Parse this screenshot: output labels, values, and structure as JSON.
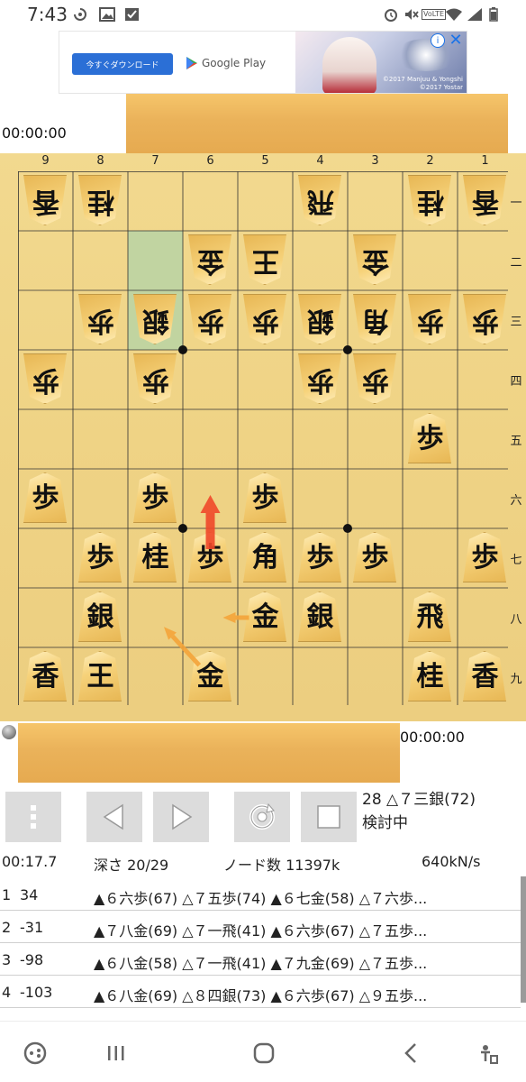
{
  "status_bar": {
    "time": "7:43",
    "left_icons": [
      "sync-icon",
      "image-icon",
      "check-box-icon"
    ],
    "right_icons": [
      "alarm-icon",
      "mute-icon",
      "volte-icon",
      "wifi-icon",
      "signal-icon",
      "battery-icon"
    ],
    "volte": "VoLTE"
  },
  "ad": {
    "button_label": "今すぐダウンロード",
    "store_label": "Google Play",
    "copyright_1": "©2017 Manjuu & Yongshi",
    "copyright_2": "©2017 Yostar",
    "info_symbol": "i",
    "close_symbol": "✕"
  },
  "timers": {
    "opponent": "00:00:00",
    "player": "00:00:00"
  },
  "board": {
    "file_labels": [
      "9",
      "8",
      "7",
      "6",
      "5",
      "4",
      "3",
      "2",
      "1"
    ],
    "rank_labels": [
      "一",
      "二",
      "三",
      "四",
      "五",
      "六",
      "七",
      "八",
      "九"
    ],
    "highlight_squares": [
      {
        "file": 7,
        "rank": 2
      },
      {
        "file": 7,
        "rank": 3
      }
    ],
    "pieces": [
      {
        "file": 9,
        "rank": 1,
        "char": "香",
        "side": "gote"
      },
      {
        "file": 8,
        "rank": 1,
        "char": "桂",
        "side": "gote"
      },
      {
        "file": 4,
        "rank": 1,
        "char": "飛",
        "side": "gote"
      },
      {
        "file": 2,
        "rank": 1,
        "char": "桂",
        "side": "gote"
      },
      {
        "file": 1,
        "rank": 1,
        "char": "香",
        "side": "gote"
      },
      {
        "file": 6,
        "rank": 2,
        "char": "金",
        "side": "gote"
      },
      {
        "file": 5,
        "rank": 2,
        "char": "王",
        "side": "gote"
      },
      {
        "file": 3,
        "rank": 2,
        "char": "金",
        "side": "gote"
      },
      {
        "file": 8,
        "rank": 3,
        "char": "歩",
        "side": "gote"
      },
      {
        "file": 7,
        "rank": 3,
        "char": "銀",
        "side": "gote"
      },
      {
        "file": 6,
        "rank": 3,
        "char": "歩",
        "side": "gote"
      },
      {
        "file": 5,
        "rank": 3,
        "char": "歩",
        "side": "gote"
      },
      {
        "file": 4,
        "rank": 3,
        "char": "銀",
        "side": "gote"
      },
      {
        "file": 3,
        "rank": 3,
        "char": "角",
        "side": "gote"
      },
      {
        "file": 2,
        "rank": 3,
        "char": "歩",
        "side": "gote"
      },
      {
        "file": 1,
        "rank": 3,
        "char": "歩",
        "side": "gote"
      },
      {
        "file": 9,
        "rank": 4,
        "char": "歩",
        "side": "gote"
      },
      {
        "file": 7,
        "rank": 4,
        "char": "歩",
        "side": "gote"
      },
      {
        "file": 4,
        "rank": 4,
        "char": "歩",
        "side": "gote"
      },
      {
        "file": 3,
        "rank": 4,
        "char": "歩",
        "side": "gote"
      },
      {
        "file": 2,
        "rank": 5,
        "char": "歩",
        "side": "sente"
      },
      {
        "file": 9,
        "rank": 6,
        "char": "歩",
        "side": "sente"
      },
      {
        "file": 7,
        "rank": 6,
        "char": "歩",
        "side": "sente"
      },
      {
        "file": 5,
        "rank": 6,
        "char": "歩",
        "side": "sente"
      },
      {
        "file": 8,
        "rank": 7,
        "char": "歩",
        "side": "sente"
      },
      {
        "file": 7,
        "rank": 7,
        "char": "桂",
        "side": "sente"
      },
      {
        "file": 6,
        "rank": 7,
        "char": "歩",
        "side": "sente"
      },
      {
        "file": 5,
        "rank": 7,
        "char": "角",
        "side": "sente"
      },
      {
        "file": 4,
        "rank": 7,
        "char": "歩",
        "side": "sente"
      },
      {
        "file": 3,
        "rank": 7,
        "char": "歩",
        "side": "sente"
      },
      {
        "file": 1,
        "rank": 7,
        "char": "歩",
        "side": "sente"
      },
      {
        "file": 8,
        "rank": 8,
        "char": "銀",
        "side": "sente"
      },
      {
        "file": 5,
        "rank": 8,
        "char": "金",
        "side": "sente"
      },
      {
        "file": 4,
        "rank": 8,
        "char": "銀",
        "side": "sente"
      },
      {
        "file": 2,
        "rank": 8,
        "char": "飛",
        "side": "sente"
      },
      {
        "file": 9,
        "rank": 9,
        "char": "香",
        "side": "sente"
      },
      {
        "file": 8,
        "rank": 9,
        "char": "王",
        "side": "sente"
      },
      {
        "file": 6,
        "rank": 9,
        "char": "金",
        "side": "sente"
      },
      {
        "file": 2,
        "rank": 9,
        "char": "桂",
        "side": "sente"
      },
      {
        "file": 1,
        "rank": 9,
        "char": "香",
        "side": "sente"
      }
    ],
    "arrows": [
      {
        "from": {
          "file": 6,
          "rank": 7
        },
        "to": {
          "file": 6,
          "rank": 6
        },
        "color": "#f0482a",
        "style": "bold"
      },
      {
        "from": {
          "file": 5,
          "rank": 8
        },
        "to": {
          "file": 6,
          "rank": 8
        },
        "color": "#f4a43a",
        "style": "thin"
      },
      {
        "from": {
          "file": 6,
          "rank": 9
        },
        "to": {
          "file": 7,
          "rank": 8
        },
        "color": "#f4a43a",
        "style": "thin"
      }
    ]
  },
  "toolbar": {
    "buttons": [
      "menu-button",
      "prev-button",
      "next-button",
      "refresh-button",
      "stop-button"
    ],
    "move_line": "28 △７三銀(72)",
    "status": "検討中"
  },
  "analysis": {
    "elapsed": "00:17.7",
    "depth": "深さ  20/29",
    "nodes": "ノード数  11397k",
    "speed": "640kN/s",
    "lines": [
      {
        "rank": "1",
        "score": "34",
        "pv": "▲６六歩(67) △７五歩(74) ▲６七金(58) △７六歩..."
      },
      {
        "rank": "2",
        "score": "-31",
        "pv": "▲７八金(69) △７一飛(41) ▲６六歩(67) △７五歩..."
      },
      {
        "rank": "3",
        "score": "-98",
        "pv": "▲６八金(58) △７一飛(41) ▲７九金(69) △７五歩..."
      },
      {
        "rank": "4",
        "score": "-103",
        "pv": "▲６八金(69) △８四銀(73) ▲６六歩(67) △９五歩..."
      }
    ]
  },
  "nav_bar": [
    "game-launcher-icon",
    "recent-apps-icon",
    "home-icon",
    "back-icon",
    "accessibility-icon"
  ]
}
